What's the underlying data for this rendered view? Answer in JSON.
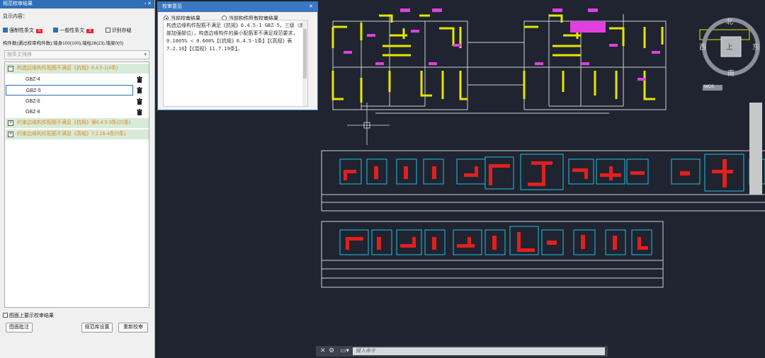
{
  "left_panel": {
    "title": "规范校审结果",
    "display_label": "显示内容：",
    "filters": [
      {
        "label": "强制性条文",
        "count": "0",
        "checked": true
      },
      {
        "label": "一般性条文",
        "count": "3",
        "checked": true
      },
      {
        "label": "识别存疑",
        "checked": false
      }
    ],
    "summary": "构件数(通过校审构件数):墙身100(100),墙柱26(23),墙梁0(0)",
    "sort_placeholder": "按条文排序",
    "groups": [
      {
        "label": "构造边缘构件配筋不满足《抗规》6.4.5-1(4条)",
        "expanded": true,
        "toggle": "−"
      },
      {
        "label": "约束边缘构件配筋不满足《抗规》第6.4.5-3条(22条)",
        "expanded": false,
        "toggle": "+"
      },
      {
        "label": "约束边缘构件配筋不满足《高规》7.2.16-4条(5条)",
        "expanded": false,
        "toggle": "+"
      }
    ],
    "items": [
      "GBZ-4",
      "GBZ-5",
      "GBZ-6",
      "GBZ-8"
    ],
    "show_on_drawing": "图面上要示校审结果",
    "buttons": {
      "annotate": "图面批注",
      "rule_settings": "规范库设置",
      "recheck": "重新校审"
    }
  },
  "dialog": {
    "title": "校审意见",
    "radio_current": "当前校审结果",
    "radio_all": "当前构件所有校审结果",
    "message": "构造边缘构件配筋不满足《抗规》6.4.5-1 GBZ-5，三级（底部加强部位），构造边缘构件的最小配筋率不满足规范要求，0.1005% < 0.600%【《抗规》6.4.5-1条】【《高规》表7.2.16】【《混规》11.7.19条】。"
  },
  "cad": {
    "compass": {
      "north": "北",
      "south": "南",
      "east": "东",
      "west": "西",
      "center": "上",
      "ucs": "WCS"
    },
    "command_placeholder": "键入命令",
    "colors": {
      "background": "#1f2430",
      "wall": "#e6e600",
      "label": "#e040e0",
      "rebar": "#e02020",
      "dim": "#20c0e0"
    }
  }
}
